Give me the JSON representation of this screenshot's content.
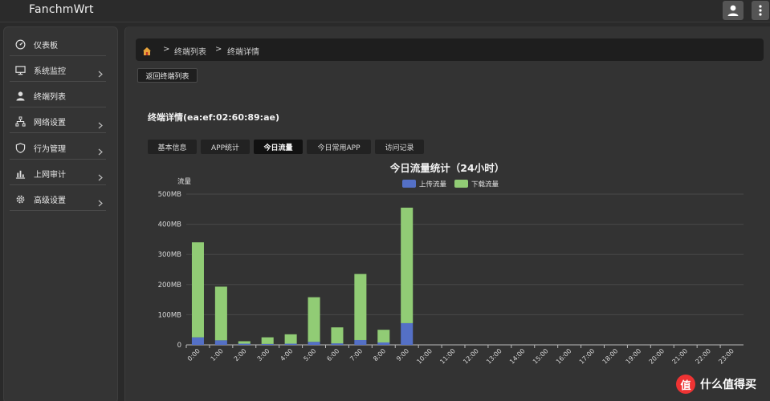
{
  "app": {
    "title": "FanchmWrt"
  },
  "sidebar": {
    "items": [
      {
        "label": "仪表板",
        "icon": "dashboard-icon",
        "has_children": false
      },
      {
        "label": "系统监控",
        "icon": "monitor-icon",
        "has_children": true
      },
      {
        "label": "终端列表",
        "icon": "user-icon",
        "has_children": false
      },
      {
        "label": "网络设置",
        "icon": "network-icon",
        "has_children": true
      },
      {
        "label": "行为管理",
        "icon": "shield-icon",
        "has_children": true
      },
      {
        "label": "上网审计",
        "icon": "audit-icon",
        "has_children": true
      },
      {
        "label": "高级设置",
        "icon": "gear-icon",
        "has_children": true
      }
    ]
  },
  "breadcrumb": {
    "sep": ">",
    "items": [
      "终端列表",
      "终端详情"
    ]
  },
  "toolbar": {
    "back_label": "返回终端列表"
  },
  "detail": {
    "title": "终端详情(ea:ef:02:60:89:ae)"
  },
  "tabs": [
    {
      "label": "基本信息",
      "active": false
    },
    {
      "label": "APP统计",
      "active": false
    },
    {
      "label": "今日流量",
      "active": true
    },
    {
      "label": "今日常用APP",
      "active": false
    },
    {
      "label": "访问记录",
      "active": false
    }
  ],
  "watermark": {
    "badge": "值",
    "text": "什么值得买"
  },
  "colors": {
    "upload": "#5470c6",
    "download": "#91cc75",
    "accent": "#e33333"
  },
  "chart_data": {
    "type": "bar",
    "stacked": true,
    "title": "今日流量统计（24小时）",
    "ylabel": "流量",
    "xlabel": "",
    "ylim": [
      0,
      500
    ],
    "yticks": [
      "0",
      "100MB",
      "200MB",
      "300MB",
      "400MB",
      "500MB"
    ],
    "legend_position": "top-center",
    "categories": [
      "0:00",
      "1:00",
      "2:00",
      "3:00",
      "4:00",
      "5:00",
      "6:00",
      "7:00",
      "8:00",
      "9:00",
      "10:00",
      "11:00",
      "12:00",
      "13:00",
      "14:00",
      "15:00",
      "16:00",
      "17:00",
      "18:00",
      "19:00",
      "20:00",
      "21:00",
      "22:00",
      "23:00"
    ],
    "series": [
      {
        "name": "上传流量",
        "values": [
          25,
          15,
          4,
          3,
          4,
          10,
          5,
          16,
          8,
          72,
          0,
          0,
          0,
          0,
          0,
          0,
          0,
          0,
          0,
          0,
          0,
          0,
          0,
          0
        ]
      },
      {
        "name": "下载流量",
        "values": [
          315,
          178,
          8,
          22,
          31,
          148,
          53,
          219,
          42,
          383,
          0,
          0,
          0,
          0,
          0,
          0,
          0,
          0,
          0,
          0,
          0,
          0,
          0,
          0
        ]
      }
    ]
  }
}
